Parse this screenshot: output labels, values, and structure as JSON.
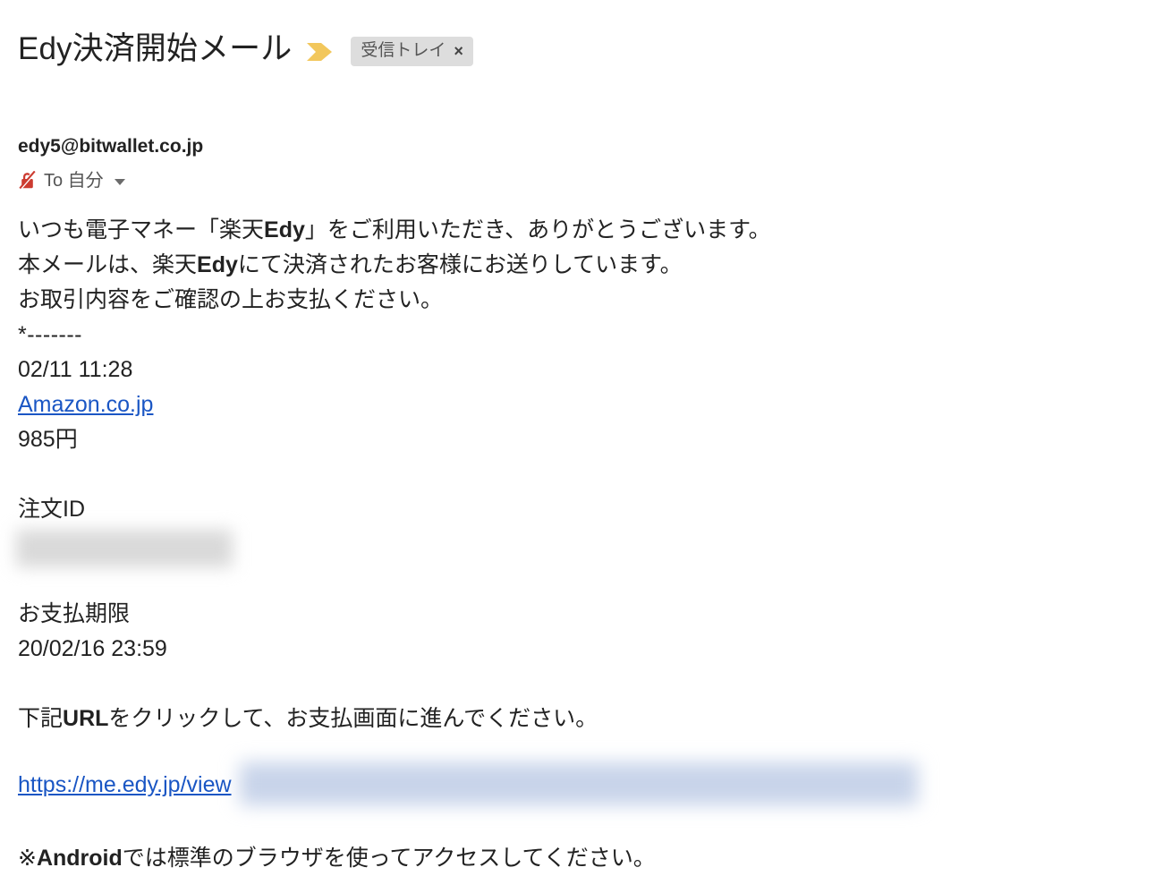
{
  "header": {
    "subject": "Edy決済開始メール",
    "importance_marker_icon": "yellow-chevron-importance-icon",
    "label": {
      "name": "受信トレイ",
      "remove": "×"
    }
  },
  "message": {
    "sender_email": "edy5@bitwallet.co.jp",
    "encryption_icon": "no-encryption-icon",
    "recipient": "To 自分",
    "details_caret": "chevron-down-icon"
  },
  "body": {
    "greeting_line1_a": "いつも電子マネー「楽天",
    "greeting_line1_b": "Edy",
    "greeting_line1_c": "」をご利用いただき、ありがとうございます。",
    "line2_a": "本メールは、楽天",
    "line2_b": "Edy",
    "line2_c": "にて決済されたお客様にお送りしています。",
    "line3": "お取引内容をご確認の上お支払ください。",
    "separator": "*-------",
    "transaction_datetime": "02/11 11:28",
    "merchant_link": "Amazon.co.jp",
    "amount": "985円",
    "order_id_label": "注文ID",
    "order_id_value": "",
    "due_label": "お支払期限",
    "due_value": "20/02/16 23:59",
    "instruction_a": "下記",
    "instruction_b": "URL",
    "instruction_c": "をクリックして、お支払画面に進んでください。",
    "payment_url": "https://me.edy.jp/view",
    "payment_url_redacted": "",
    "note_a": "※",
    "note_b": "Android",
    "note_c": "では標準のブラウザを使ってアクセスしてください。"
  },
  "colors": {
    "link": "#1a56c4",
    "importance_marker": "#f2c75c",
    "chip_background": "#dddddd",
    "chip_text": "#555555",
    "encryption_warning": "#cc3b30",
    "body_text": "#222222"
  }
}
